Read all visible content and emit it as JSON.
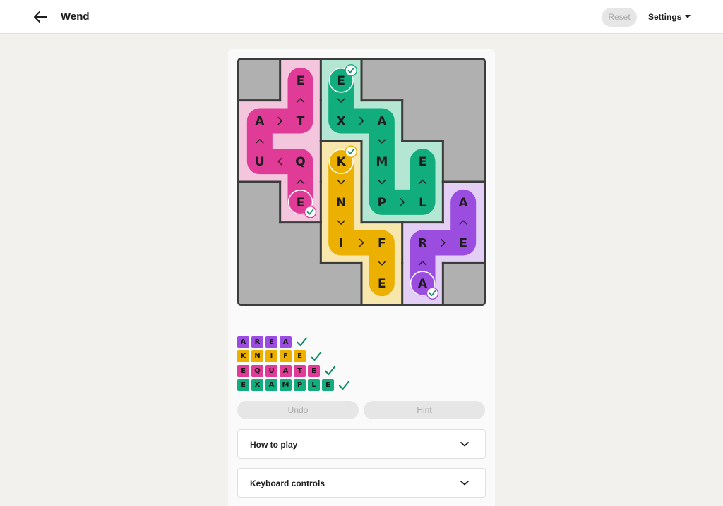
{
  "header": {
    "title": "Wend",
    "reset_label": "Reset",
    "settings_label": "Settings"
  },
  "colors": {
    "purple": "#9b4de0",
    "purple_light": "#e3cff5",
    "yellow": "#ebb000",
    "yellow_light": "#f8e7ad",
    "pink": "#df3b97",
    "pink_light": "#f4c6de",
    "green": "#12ad7d",
    "green_light": "#b3e6d3",
    "blocked": "#b0b0b0"
  },
  "board": {
    "rows": 6,
    "cols": 6,
    "regions": [
      {
        "word": "AREA",
        "color": "purple",
        "cells": [
          [
            5,
            4
          ],
          [
            5,
            5
          ],
          [
            6,
            5
          ],
          [
            6,
            4
          ]
        ]
      },
      {
        "word": "KNIFE",
        "color": "yellow",
        "cells": [
          [
            3,
            3
          ],
          [
            3,
            4
          ],
          [
            3,
            5
          ],
          [
            4,
            5
          ],
          [
            4,
            6
          ]
        ]
      },
      {
        "word": "EQUATE",
        "color": "pink",
        "cells": [
          [
            4,
            4
          ],
          [
            4,
            3
          ],
          [
            3,
            3
          ],
          [
            3,
            2
          ],
          [
            4,
            2
          ],
          [
            4,
            1
          ]
        ]
      },
      {
        "word": "EXAMPLE",
        "color": "green",
        "cells": [
          [
            3,
            1
          ],
          [
            3,
            2
          ],
          [
            4,
            2
          ],
          [
            4,
            3
          ],
          [
            4,
            4
          ],
          [
            5,
            4
          ],
          [
            5,
            3
          ]
        ]
      }
    ],
    "cells": [
      {
        "row": 1,
        "col": 1,
        "letter": "",
        "fill": "blocked"
      },
      {
        "row": 1,
        "col": 2,
        "letter": "E",
        "fill": "pink"
      },
      {
        "row": 1,
        "col": 3,
        "letter": "E",
        "fill": "green"
      },
      {
        "row": 1,
        "col": 4,
        "letter": "",
        "fill": "blocked"
      },
      {
        "row": 1,
        "col": 5,
        "letter": "",
        "fill": "blocked"
      },
      {
        "row": 1,
        "col": 6,
        "letter": "",
        "fill": "blocked"
      },
      {
        "row": 2,
        "col": 1,
        "letter": "A",
        "fill": "pink"
      },
      {
        "row": 2,
        "col": 2,
        "letter": "T",
        "fill": "pink"
      },
      {
        "row": 2,
        "col": 3,
        "letter": "X",
        "fill": "green"
      },
      {
        "row": 2,
        "col": 4,
        "letter": "A",
        "fill": "green"
      },
      {
        "row": 2,
        "col": 5,
        "letter": "",
        "fill": "blocked"
      },
      {
        "row": 2,
        "col": 6,
        "letter": "",
        "fill": "blocked"
      },
      {
        "row": 3,
        "col": 1,
        "letter": "U",
        "fill": "pink"
      },
      {
        "row": 3,
        "col": 2,
        "letter": "Q",
        "fill": "pink"
      },
      {
        "row": 3,
        "col": 3,
        "letter": "K",
        "fill": "yellow"
      },
      {
        "row": 3,
        "col": 4,
        "letter": "M",
        "fill": "green"
      },
      {
        "row": 3,
        "col": 5,
        "letter": "E",
        "fill": "green"
      },
      {
        "row": 3,
        "col": 6,
        "letter": "",
        "fill": "blocked"
      },
      {
        "row": 4,
        "col": 1,
        "letter": "",
        "fill": "blocked"
      },
      {
        "row": 4,
        "col": 2,
        "letter": "E",
        "fill": "pink"
      },
      {
        "row": 4,
        "col": 3,
        "letter": "N",
        "fill": "yellow"
      },
      {
        "row": 4,
        "col": 4,
        "letter": "P",
        "fill": "green"
      },
      {
        "row": 4,
        "col": 5,
        "letter": "L",
        "fill": "green"
      },
      {
        "row": 4,
        "col": 6,
        "letter": "A",
        "fill": "purple"
      },
      {
        "row": 5,
        "col": 1,
        "letter": "",
        "fill": "blocked"
      },
      {
        "row": 5,
        "col": 2,
        "letter": "",
        "fill": "blocked"
      },
      {
        "row": 5,
        "col": 3,
        "letter": "I",
        "fill": "yellow"
      },
      {
        "row": 5,
        "col": 4,
        "letter": "F",
        "fill": "yellow"
      },
      {
        "row": 5,
        "col": 5,
        "letter": "R",
        "fill": "purple"
      },
      {
        "row": 5,
        "col": 6,
        "letter": "E",
        "fill": "purple"
      },
      {
        "row": 6,
        "col": 1,
        "letter": "",
        "fill": "blocked"
      },
      {
        "row": 6,
        "col": 2,
        "letter": "",
        "fill": "blocked"
      },
      {
        "row": 6,
        "col": 3,
        "letter": "",
        "fill": "blocked"
      },
      {
        "row": 6,
        "col": 4,
        "letter": "E",
        "fill": "yellow"
      },
      {
        "row": 6,
        "col": 5,
        "letter": "A",
        "fill": "purple"
      },
      {
        "row": 6,
        "col": 6,
        "letter": "",
        "fill": "blocked"
      }
    ],
    "paths": [
      {
        "word": "EQUATE",
        "color": "pink",
        "start_check": [
          4,
          2
        ],
        "cells": [
          [
            4,
            2
          ],
          [
            3,
            2
          ],
          [
            3,
            1
          ],
          [
            2,
            1
          ],
          [
            2,
            2
          ],
          [
            1,
            2
          ]
        ]
      },
      {
        "word": "EXAMPLE",
        "color": "green",
        "start_check": [
          1,
          3
        ],
        "cells": [
          [
            1,
            3
          ],
          [
            2,
            3
          ],
          [
            2,
            4
          ],
          [
            3,
            4
          ],
          [
            4,
            4
          ],
          [
            4,
            5
          ],
          [
            3,
            5
          ]
        ]
      },
      {
        "word": "KNIFE",
        "color": "yellow",
        "start_check": [
          3,
          3
        ],
        "cells": [
          [
            3,
            3
          ],
          [
            4,
            3
          ],
          [
            5,
            3
          ],
          [
            5,
            4
          ],
          [
            6,
            4
          ]
        ]
      },
      {
        "word": "AREA",
        "color": "purple",
        "start_check": [
          6,
          5
        ],
        "cells": [
          [
            6,
            5
          ],
          [
            5,
            5
          ],
          [
            5,
            6
          ],
          [
            4,
            6
          ]
        ]
      }
    ]
  },
  "words": [
    {
      "word": "AREA",
      "letters": [
        "A",
        "R",
        "E",
        "A"
      ],
      "color": "purple",
      "solved": true
    },
    {
      "word": "KNIFE",
      "letters": [
        "K",
        "N",
        "I",
        "F",
        "E"
      ],
      "color": "yellow",
      "solved": true
    },
    {
      "word": "EQUATE",
      "letters": [
        "E",
        "Q",
        "U",
        "A",
        "T",
        "E"
      ],
      "color": "pink",
      "solved": true
    },
    {
      "word": "EXAMPLE",
      "letters": [
        "E",
        "X",
        "A",
        "M",
        "P",
        "L",
        "E"
      ],
      "color": "green",
      "solved": true
    }
  ],
  "buttons": {
    "undo_label": "Undo",
    "hint_label": "Hint"
  },
  "accordions": {
    "how_to_play": "How to play",
    "keyboard_controls": "Keyboard controls"
  }
}
